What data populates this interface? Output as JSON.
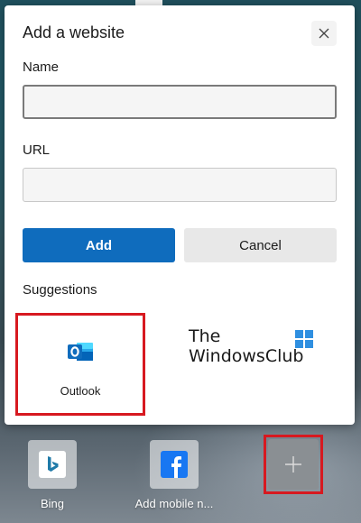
{
  "dialog": {
    "title": "Add a website",
    "close_icon": "close-icon",
    "name_label": "Name",
    "name_value": "",
    "url_label": "URL",
    "url_value": "",
    "add_label": "Add",
    "cancel_label": "Cancel",
    "suggestions_label": "Suggestions",
    "suggestions": [
      {
        "label": "Outlook",
        "icon": "outlook-icon",
        "color": "#0f6cbd"
      }
    ]
  },
  "watermark": {
    "line1": "The",
    "line2": "WindowsClub",
    "logo": "windows-logo"
  },
  "quick_links": [
    {
      "label": "Bing",
      "icon": "bing-icon",
      "color": "#1f7aa8"
    },
    {
      "label": "Add mobile n...",
      "icon": "facebook-icon",
      "color": "#1877f2"
    }
  ],
  "add_tile": {
    "icon": "plus-icon"
  },
  "colors": {
    "primary": "#0f6cbd",
    "highlight": "#d71920"
  }
}
